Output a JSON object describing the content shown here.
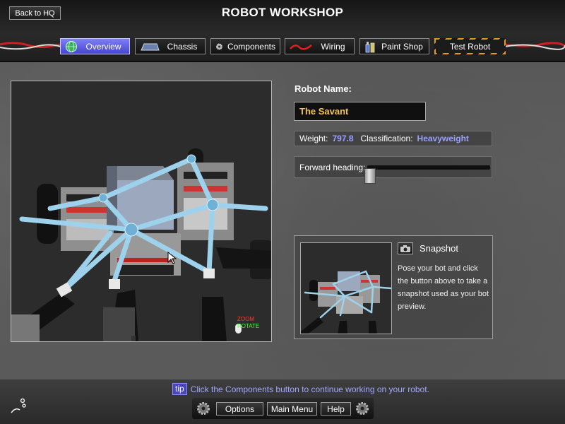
{
  "header": {
    "back_label": "Back to HQ",
    "title": "ROBOT WORKSHOP"
  },
  "tabs": [
    {
      "label": "Overview",
      "icon": "globe-icon",
      "active": true
    },
    {
      "label": "Chassis",
      "icon": "chassis-icon",
      "active": false
    },
    {
      "label": "Components",
      "icon": "gear-icon",
      "active": false
    },
    {
      "label": "Wiring",
      "icon": "wire-icon",
      "active": false
    },
    {
      "label": "Paint Shop",
      "icon": "paint-icon",
      "active": false
    },
    {
      "label": "Test Robot",
      "icon": "",
      "active": false
    }
  ],
  "viewport": {
    "zoom_hint": "ZOOM",
    "rotate_hint": "ROTATE"
  },
  "robot": {
    "name_label": "Robot Name:",
    "name_value": "The Savant",
    "weight_label": "Weight:",
    "weight_value": "797.8",
    "class_label": "Classification:",
    "class_value": "Heavyweight",
    "heading_label": "Forward heading:",
    "heading_value": 0.02
  },
  "snapshot": {
    "title": "Snapshot",
    "description": "Pose your bot and click the button above to take a snapshot used as your bot preview."
  },
  "footer": {
    "tip_tag": "tip",
    "tip_text": "Click the Components button to continue working on your robot.",
    "options_label": "Options",
    "main_menu_label": "Main Menu",
    "help_label": "Help"
  },
  "colors": {
    "accent_active_tab": "#5a5ae0",
    "robot_name": "#f4c25a",
    "stat_value": "#9aa0ff",
    "tip_text": "#a3a7ff",
    "hazard_stripe": "#e59b1c"
  }
}
